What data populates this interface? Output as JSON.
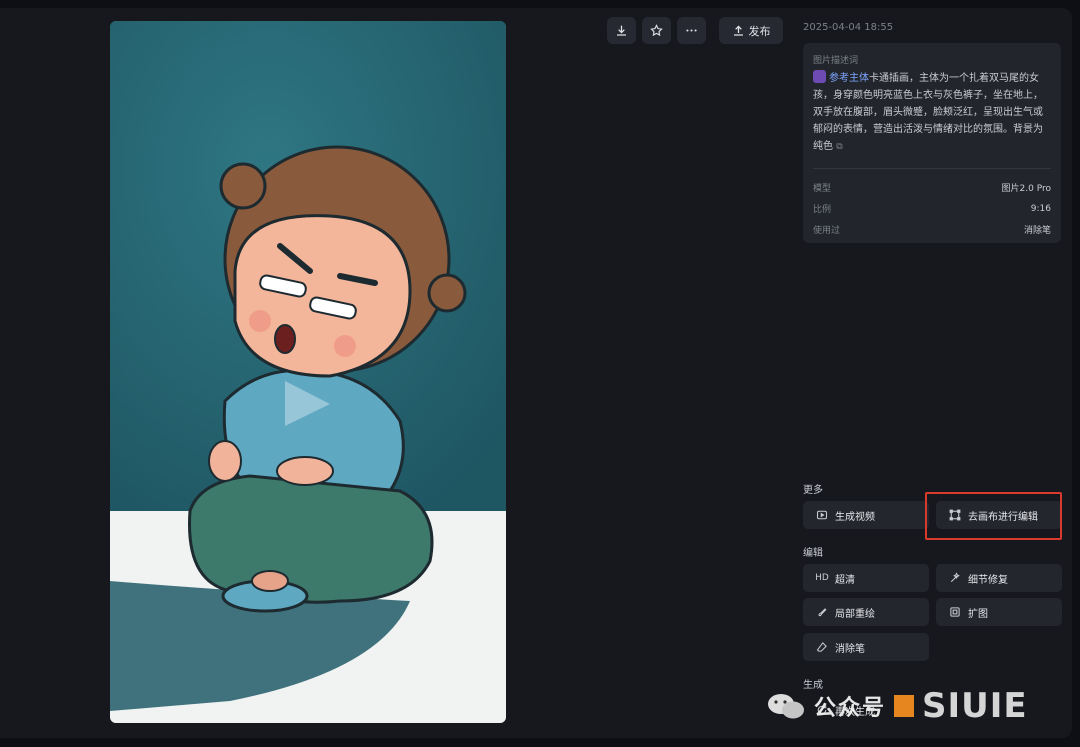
{
  "toolbar": {
    "publish_label": "发布"
  },
  "timestamp": "2025-04-04 18:55",
  "description": {
    "title": "图片描述词",
    "ref_tag": "参考主体",
    "text": "卡通插画，主体为一个扎着双马尾的女孩，身穿颜色明亮蓝色上衣与灰色裤子，坐在地上，双手放在腹部，眉头微蹙，脸颊泛红，呈现出生气或郁闷的表情，营造出活泼与情绪对比的氛围。背景为纯色",
    "copy_icon": "copy-icon",
    "meta": [
      {
        "key": "模型",
        "value": "图片2.0 Pro"
      },
      {
        "key": "比例",
        "value": "9:16"
      },
      {
        "key": "使用过",
        "value": "消除笔"
      }
    ]
  },
  "sections": {
    "more": "更多",
    "edit": "编辑",
    "generate": "生成"
  },
  "actions": {
    "gen_video": "生成视频",
    "canvas_edit": "去画布进行编辑",
    "hd": "超清",
    "hd_badge": "HD",
    "detail_fix": "细节修复",
    "inpaint": "局部重绘",
    "expand": "扩图",
    "eraser": "消除笔",
    "regenerate": "再次生成"
  },
  "watermark": {
    "text": "公众号",
    "logo": "SIUIE"
  },
  "colors": {
    "background": "#16181e",
    "card": "#22252c",
    "highlight": "#d83a2e"
  }
}
